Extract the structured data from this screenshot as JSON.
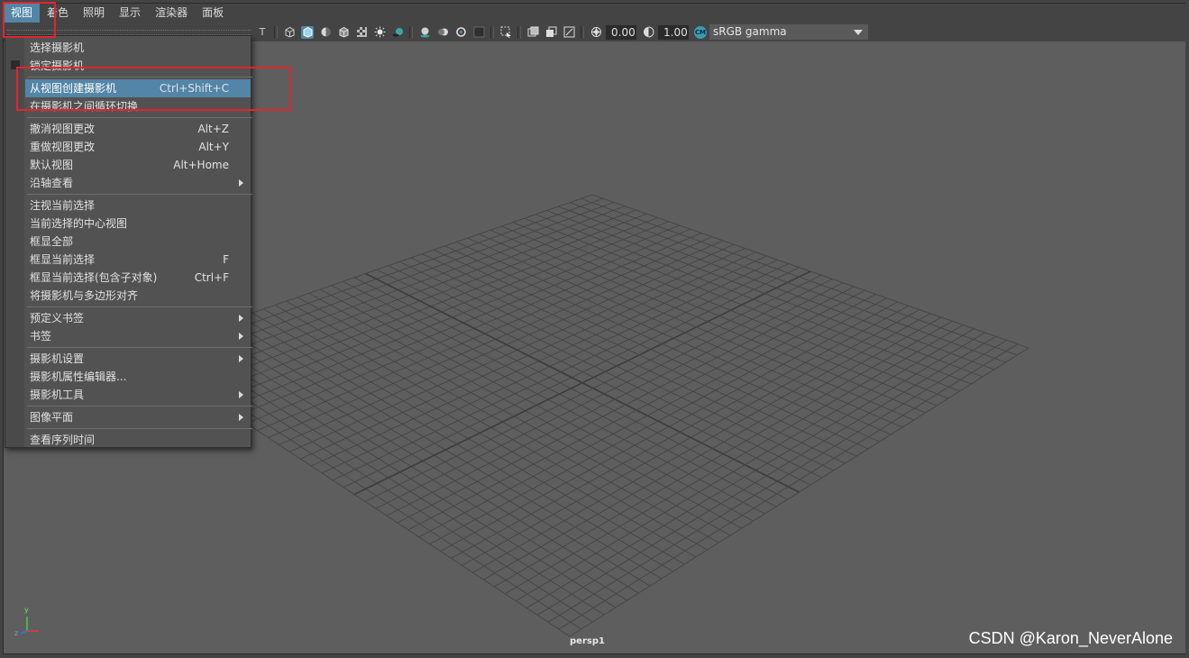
{
  "menubar": {
    "items": [
      "视图",
      "着色",
      "照明",
      "显示",
      "渲染器",
      "面板"
    ]
  },
  "toolbar": {
    "exposure": "0.00",
    "gamma": "1.00",
    "color_space_icon": "CM",
    "color_space": "sRGB gamma"
  },
  "view_menu": {
    "items": [
      {
        "label": "选择摄影机",
        "shortcut": ""
      },
      {
        "label": "锁定摄影机",
        "shortcut": ""
      },
      {
        "label": "从视图创建摄影机",
        "shortcut": "Ctrl+Shift+C"
      },
      {
        "label": "在摄影机之间循环切换",
        "shortcut": ""
      },
      {
        "label": "撤消视图更改",
        "shortcut": "Alt+Z"
      },
      {
        "label": "重做视图更改",
        "shortcut": "Alt+Y"
      },
      {
        "label": "默认视图",
        "shortcut": "Alt+Home"
      },
      {
        "label": "沿轴查看",
        "shortcut": ""
      },
      {
        "label": "注视当前选择",
        "shortcut": ""
      },
      {
        "label": "当前选择的中心视图",
        "shortcut": ""
      },
      {
        "label": "框显全部",
        "shortcut": ""
      },
      {
        "label": "框显当前选择",
        "shortcut": "F"
      },
      {
        "label": "框显当前选择(包含子对象)",
        "shortcut": "Ctrl+F"
      },
      {
        "label": "将摄影机与多边形对齐",
        "shortcut": ""
      },
      {
        "label": "预定义书签",
        "shortcut": ""
      },
      {
        "label": "书签",
        "shortcut": ""
      },
      {
        "label": "摄影机设置",
        "shortcut": ""
      },
      {
        "label": "摄影机属性编辑器...",
        "shortcut": ""
      },
      {
        "label": "摄影机工具",
        "shortcut": ""
      },
      {
        "label": "图像平面",
        "shortcut": ""
      },
      {
        "label": "查看序列时间",
        "shortcut": ""
      }
    ]
  },
  "viewport": {
    "camera": "persp1",
    "axis_y": "y",
    "axis_z": "z"
  },
  "watermark": "CSDN @Karon_NeverAlone",
  "colors": {
    "highlight": "#5285a6",
    "annotation": "#e0252f",
    "viewport_bg": "#5e5e5e"
  }
}
